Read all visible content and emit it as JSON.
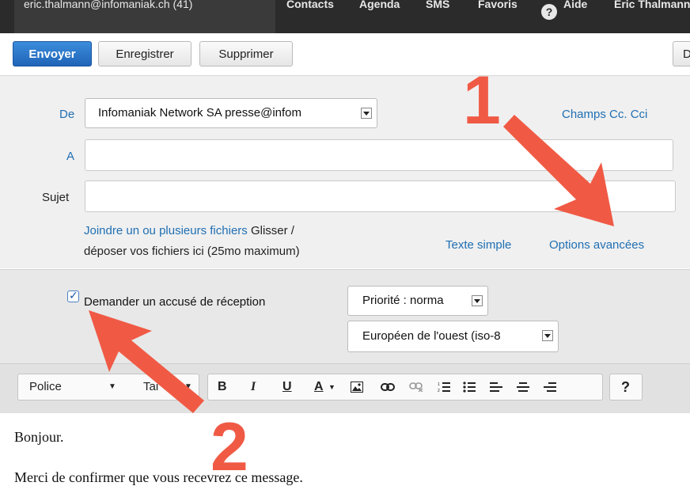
{
  "nav": {
    "account": "eric.thalmann@infomaniak.ch  (41)",
    "contacts": "Contacts",
    "agenda": "Agenda",
    "sms": "SMS",
    "favoris": "Favoris",
    "aide": "Aide",
    "user": "Eric Thalmann"
  },
  "toolbar": {
    "send": "Envoyer",
    "save": "Enregistrer",
    "delete": "Supprimer",
    "cut_button": "D"
  },
  "form": {
    "from_label": "De",
    "from_value": "Infomaniak Network SA presse@infom",
    "cc_link": "Champs Cc. Cci",
    "to_label": "A",
    "subject_label": "Sujet",
    "attach_link": "Joindre un ou plusieurs fichiers",
    "attach_text1": "Glisser /",
    "attach_text2": "déposer vos fichiers ici (25mo maximum)",
    "plain_text_link": "Texte simple",
    "advanced_link": "Options avancées"
  },
  "options": {
    "receipt_label": "Demander un accusé de réception",
    "receipt_checked": true,
    "priority_value": "Priorité : norma",
    "encoding_value": "Européen de l'ouest (iso-8"
  },
  "editor_toolbar": {
    "font_select": "Police",
    "size_select": "Tai",
    "bold": "B",
    "italic": "I",
    "underline": "U",
    "font_color": "A",
    "help": "?"
  },
  "editor": {
    "line1": "Bonjour.",
    "line2": "Merci de confirmer que vous recevrez ce message."
  },
  "annotations": {
    "marker1": "1",
    "marker2": "2",
    "arrow_color": "#f05a45"
  }
}
